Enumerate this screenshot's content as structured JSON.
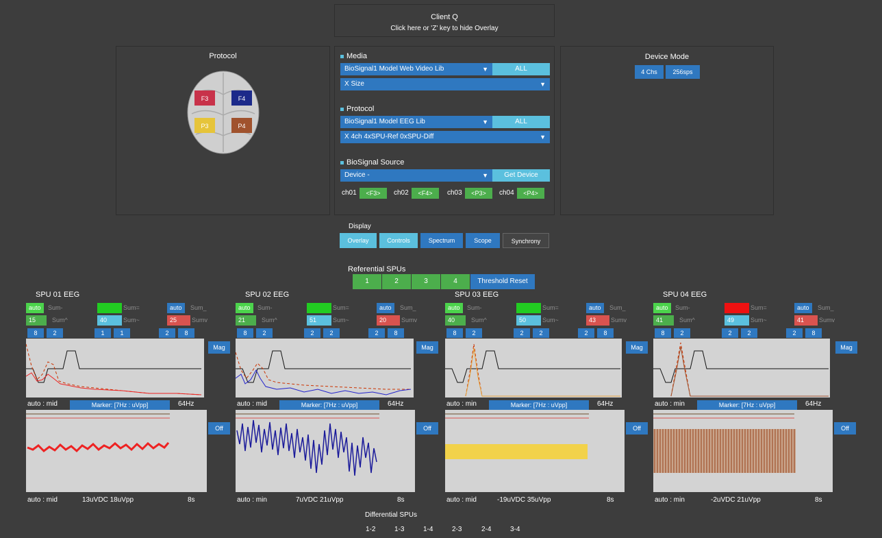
{
  "overlay": {
    "title": "Client Q",
    "hint": "Click here or 'Z' key to hide Overlay"
  },
  "protocol_panel": {
    "title": "Protocol",
    "electrodes": [
      "F3",
      "F4",
      "P3",
      "P4"
    ]
  },
  "media": {
    "title": "Media",
    "library": "BioSignal1 Model Web Video Lib",
    "all_label": "ALL",
    "size": "X Size"
  },
  "protocol": {
    "title": "Protocol",
    "library": "BioSignal1 Model EEG Lib",
    "all_label": "ALL",
    "config": "X 4ch 4xSPU-Ref 0xSPU-Diff"
  },
  "source": {
    "title": "BioSignal Source",
    "device": "Device -",
    "get_label": "Get Device",
    "channels": [
      {
        "label": "ch01",
        "value": "<F3>"
      },
      {
        "label": "ch02",
        "value": "<F4>"
      },
      {
        "label": "ch03",
        "value": "<P3>"
      },
      {
        "label": "ch04",
        "value": "<P4>"
      }
    ]
  },
  "device_mode": {
    "title": "Device Mode",
    "chs": "4 Chs",
    "sps": "256sps"
  },
  "display": {
    "title": "Display",
    "buttons": [
      "Overlay",
      "Controls",
      "Spectrum",
      "Scope",
      "Synchrony"
    ]
  },
  "referential": {
    "title": "Referential SPUs",
    "buttons": [
      "1",
      "2",
      "3",
      "4"
    ],
    "reset": "Threshold Reset"
  },
  "colors": {
    "accent": "#2f78c0",
    "light": "#5bc0de",
    "green": "#4cae4c",
    "red": "#d9534f"
  },
  "spus": [
    {
      "title": "SPU 01 EEG",
      "c1": {
        "lab": "auto",
        "txt": "Sum-"
      },
      "c2": {
        "lab": "",
        "txt": "Sum="
      },
      "c3": {
        "lab": "auto",
        "txt": "Sum_"
      },
      "c4": {
        "lab": "15",
        "txt": "Sum^"
      },
      "c5": {
        "lab": "40",
        "txt": "Sum~"
      },
      "c6": {
        "lab": "25",
        "txt": "Sumv"
      },
      "c2_color": "#22cc22",
      "nums": [
        "8",
        "2",
        "1",
        "1",
        "2",
        "8"
      ],
      "spec_left": "auto : mid",
      "spec_right": "64Hz",
      "marker": "Marker: [7Hz : uVpp]",
      "side_top": "Mag",
      "side_bottom": "Off",
      "scope_left": "auto : mid",
      "scope_mid": "13uVDC 18uVpp",
      "scope_right": "8s",
      "trace_color": "#ee2222"
    },
    {
      "title": "SPU 02 EEG",
      "c1": {
        "lab": "auto",
        "txt": "Sum-"
      },
      "c2": {
        "lab": "",
        "txt": "Sum="
      },
      "c3": {
        "lab": "auto",
        "txt": "Sum_"
      },
      "c4": {
        "lab": "21",
        "txt": "Sum^"
      },
      "c5": {
        "lab": "51",
        "txt": "Sum~"
      },
      "c6": {
        "lab": "20",
        "txt": "Sumv"
      },
      "c2_color": "#22cc22",
      "nums": [
        "8",
        "2",
        "2",
        "2",
        "2",
        "8"
      ],
      "spec_left": "auto : mid",
      "spec_right": "64Hz",
      "marker": "Marker: [7Hz : uVpp]",
      "side_top": "Mag",
      "side_bottom": "Off",
      "scope_left": "auto : min",
      "scope_mid": "7uVDC 21uVpp",
      "scope_right": "8s",
      "trace_color": "#1a1a9a"
    },
    {
      "title": "SPU 03 EEG",
      "c1": {
        "lab": "auto",
        "txt": "Sum-"
      },
      "c2": {
        "lab": "",
        "txt": "Sum="
      },
      "c3": {
        "lab": "auto",
        "txt": "Sum_"
      },
      "c4": {
        "lab": "40",
        "txt": "Sum^"
      },
      "c5": {
        "lab": "50",
        "txt": "Sum~"
      },
      "c6": {
        "lab": "43",
        "txt": "Sumv"
      },
      "c2_color": "#22cc22",
      "nums": [
        "8",
        "2",
        "2",
        "2",
        "2",
        "8"
      ],
      "spec_left": "auto : min",
      "spec_right": "64Hz",
      "marker": "Marker: [7Hz : uVpp]",
      "side_top": "Mag",
      "side_bottom": "Off",
      "scope_left": "auto : mid",
      "scope_mid": "-19uVDC 35uVpp",
      "scope_right": "8s",
      "trace_color": "#f2d24a"
    },
    {
      "title": "SPU 04 EEG",
      "c1": {
        "lab": "auto",
        "txt": "Sum-"
      },
      "c2": {
        "lab": "",
        "txt": "Sum="
      },
      "c3": {
        "lab": "auto",
        "txt": "Sum_"
      },
      "c4": {
        "lab": "41",
        "txt": "Sum^"
      },
      "c5": {
        "lab": "49",
        "txt": "Sum~"
      },
      "c6": {
        "lab": "41",
        "txt": "Sumv"
      },
      "c2_color": "#ee1111",
      "nums": [
        "8",
        "2",
        "2",
        "2",
        "2",
        "8"
      ],
      "spec_left": "auto : min",
      "spec_right": "64Hz",
      "marker": "Marker: [7Hz : uVpp]",
      "side_top": "Mag",
      "side_bottom": "Off",
      "scope_left": "auto : min",
      "scope_mid": "-2uVDC 21uVpp",
      "scope_right": "8s",
      "trace_color": "#a0522d"
    }
  ],
  "differential": {
    "title": "Differential SPUs",
    "buttons": [
      "1-2",
      "1-3",
      "1-4",
      "2-3",
      "2-4",
      "3-4"
    ]
  }
}
